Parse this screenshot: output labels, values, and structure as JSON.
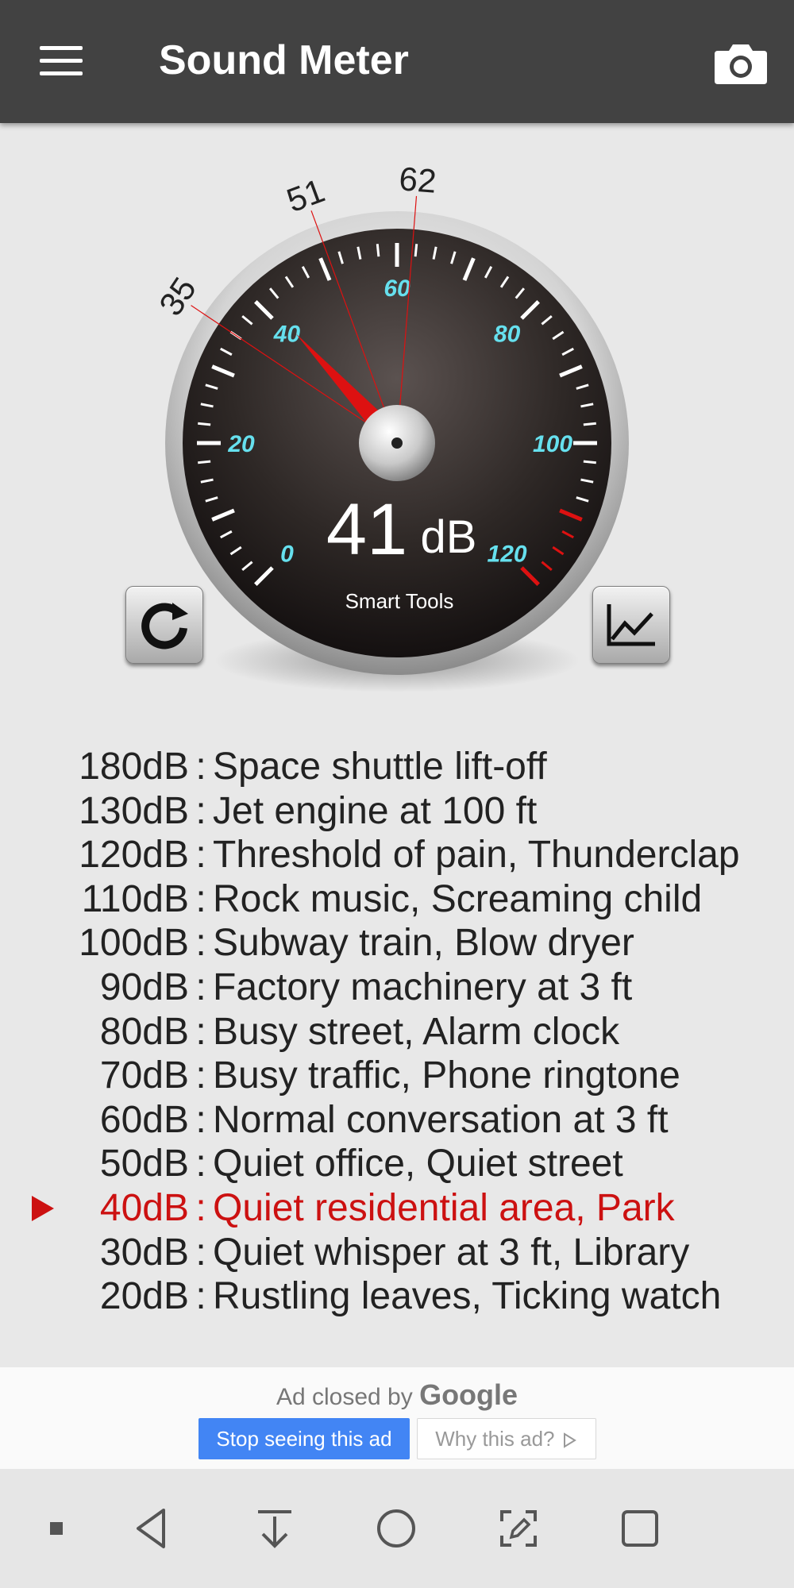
{
  "app_bar": {
    "title": "Sound Meter",
    "menu_icon": "hamburger-menu-icon",
    "camera_icon": "camera-icon",
    "background": "#424242"
  },
  "gauge": {
    "current_value": "41",
    "unit": "dB",
    "brand": "Smart Tools",
    "scale_labels": [
      "0",
      "20",
      "40",
      "60",
      "80",
      "100",
      "120"
    ],
    "outer_markers": [
      "35",
      "51",
      "62"
    ],
    "needle_value_db": 41,
    "accent_color": "#dd1111",
    "scale_color": "#66e0ee",
    "reset_icon": "refresh-icon",
    "history_icon": "line-chart-icon"
  },
  "reference": {
    "separator": ":",
    "active_index": 10,
    "items": [
      {
        "db": "180dB",
        "desc": "Space shuttle lift-off"
      },
      {
        "db": "130dB",
        "desc": "Jet engine at 100 ft"
      },
      {
        "db": "120dB",
        "desc": "Threshold of pain, Thunderclap"
      },
      {
        "db": "110dB",
        "desc": "Rock music, Screaming child"
      },
      {
        "db": "100dB",
        "desc": "Subway train, Blow dryer"
      },
      {
        "db": "90dB",
        "desc": "Factory machinery at 3 ft"
      },
      {
        "db": "80dB",
        "desc": "Busy street, Alarm clock"
      },
      {
        "db": "70dB",
        "desc": "Busy traffic, Phone ringtone"
      },
      {
        "db": "60dB",
        "desc": "Normal conversation at 3 ft"
      },
      {
        "db": "50dB",
        "desc": "Quiet office, Quiet street"
      },
      {
        "db": "40dB",
        "desc": "Quiet residential area, Park"
      },
      {
        "db": "30dB",
        "desc": "Quiet whisper at 3 ft, Library"
      },
      {
        "db": "20dB",
        "desc": "Rustling leaves, Ticking watch"
      }
    ],
    "highlight_color": "#cc1111"
  },
  "ad": {
    "closed_text": "Ad closed by",
    "closed_brand": "Google",
    "stop_label": "Stop seeing this ad",
    "why_label": "Why this ad?",
    "why_icon": "ad-choices-icon"
  },
  "nav": {
    "icons": [
      "stop-square-icon",
      "back-icon",
      "download-icon",
      "home-icon",
      "screenshot-edit-icon",
      "recents-icon"
    ]
  }
}
